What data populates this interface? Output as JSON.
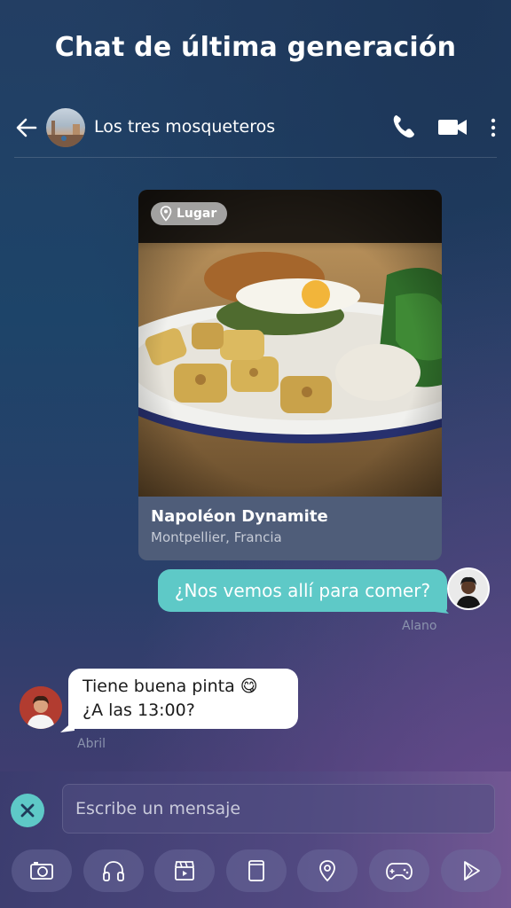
{
  "promo": {
    "title": "Chat de última generación"
  },
  "header": {
    "chat_name": "Los tres mosqueteros",
    "back_icon": "arrow-left-icon",
    "call_icon": "phone-icon",
    "video_icon": "video-camera-icon",
    "menu_icon": "more-vertical-icon"
  },
  "place_card": {
    "tag": "Lugar",
    "tag_icon": "location-pin-icon",
    "name": "Napoléon Dynamite",
    "location": "Montpellier, Francia"
  },
  "messages": [
    {
      "direction": "out",
      "text": "¿Nos vemos allí para comer?",
      "sender": "Alano"
    },
    {
      "direction": "in",
      "lines": [
        "Tiene buena pinta 😋",
        "¿A las 13:00?"
      ],
      "sender": "Abril"
    }
  ],
  "composer": {
    "placeholder": "Escribe un mensaje",
    "value": "",
    "tools": [
      "camera-icon",
      "headphones-icon",
      "clapperboard-icon",
      "card-icon",
      "location-pin-icon",
      "gamepad-icon",
      "play-icon"
    ]
  },
  "colors": {
    "accent": "#5ec9c7",
    "bubble_in": "#ffffff",
    "meta_text": "#8a93ad"
  }
}
